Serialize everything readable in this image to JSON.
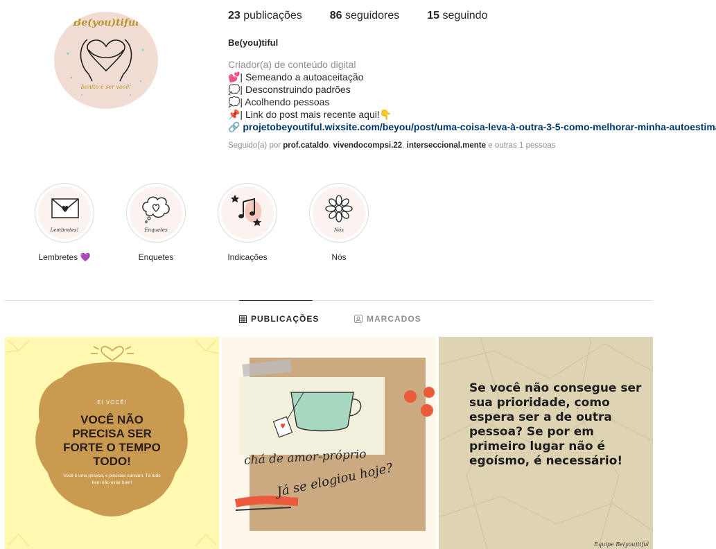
{
  "profile": {
    "avatar": {
      "title": "Be(you)tiful",
      "subtitle": "bonito é ser você!"
    },
    "stats": [
      {
        "count": "23",
        "label": "publicações"
      },
      {
        "count": "86",
        "label": "seguidores"
      },
      {
        "count": "15",
        "label": "seguindo"
      }
    ],
    "username": "Be(you)tiful",
    "category": "Criador(a) de conteúdo digital",
    "bio_lines": [
      "💕| Semeando a autoaceitação",
      "💭| Desconstruindo padrões",
      "💭| Acolhendo pessoas",
      "📌| Link do post mais recente aqui!👇"
    ],
    "link_icon": "🔗",
    "link": "projetobeyoutiful.wixsite.com/beyou/post/uma-coisa-leva-à-outra-3-5-como-melhorar-minha-autoestima",
    "followed_by": {
      "prefix": "Seguido(a) por",
      "users": [
        "prof.cataldo",
        "vivendocompsi.22",
        "interseccional.mente"
      ],
      "sep": ",",
      "suffix": "e outras 1 pessoas"
    }
  },
  "highlights": [
    {
      "label": "Lembretes 💜",
      "caption": "Lembretes!",
      "icon": "envelope-heart-icon"
    },
    {
      "label": "Enquetes",
      "caption": "Enquetes",
      "icon": "heart-bubble-icon"
    },
    {
      "label": "Indicações",
      "caption": "",
      "icon": "music-note-icon"
    },
    {
      "label": "Nós",
      "caption": "Nós",
      "icon": "flower-icon"
    }
  ],
  "tabs": [
    {
      "label": "PUBLICAÇÕES",
      "icon": "grid-icon",
      "active": true
    },
    {
      "label": "MARCADOS",
      "icon": "tag-user-icon",
      "active": false
    }
  ],
  "posts": [
    {
      "small": "EI VOCÊ!",
      "big": "VOCÊ NÃO PRECISA SER FORTE O TEMPO TODO!",
      "note": "Você é uma pessoa, e pessoas cansam. Tá tudo bem não estar bem!"
    },
    {
      "tea": "chá de amor-próprio",
      "question": "Já se elogiou hoje?"
    },
    {
      "text": "Se você não consegue ser sua prioridade, como espera ser a de outra pessoa? Se por em primeiro lugar não é egoísmo, é necessário!",
      "sign": "Equipe Be(you)tiful"
    }
  ],
  "colors": {
    "link": "#00376b",
    "muted": "#8e8e8e",
    "post1_bg": "#fff8b0",
    "post1_badge": "#c99a4f",
    "post3_bg": "#ded4b4"
  }
}
